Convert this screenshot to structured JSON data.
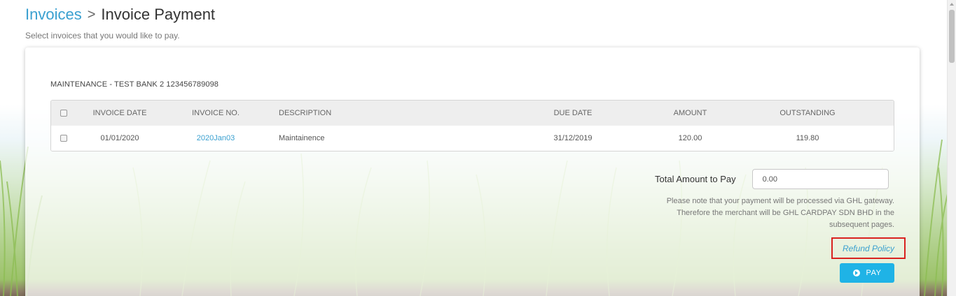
{
  "header": {
    "breadcrumb_parent": "Invoices",
    "breadcrumb_separator": ">",
    "title": "Invoice Payment",
    "subtitle": "Select invoices that you would like to pay."
  },
  "account": {
    "label": "MAINTENANCE - TEST BANK 2 123456789098"
  },
  "table": {
    "columns": [
      "INVOICE DATE",
      "INVOICE NO.",
      "DESCRIPTION",
      "DUE DATE",
      "AMOUNT",
      "OUTSTANDING"
    ],
    "rows": [
      {
        "invoice_date": "01/01/2020",
        "invoice_no": "2020Jan03",
        "description": "Maintainence",
        "due_date": "31/12/2019",
        "amount": "120.00",
        "outstanding": "119.80",
        "checked": false
      }
    ]
  },
  "payment": {
    "total_label": "Total Amount to Pay",
    "total_value": "0.00",
    "note": "Please note that your payment will be processed via GHL gateway. Therefore the merchant will be GHL CARDPAY SDN BHD in the subsequent pages.",
    "refund_label": "Refund Policy",
    "pay_label": "PAY"
  },
  "colors": {
    "accent": "#3aa0d0",
    "button": "#1fb3e6",
    "highlight": "#d9221f"
  },
  "icons": {
    "pay_icon": "arrow-circle-right-icon",
    "breadcrumb_icon": "chevron-right-icon"
  }
}
